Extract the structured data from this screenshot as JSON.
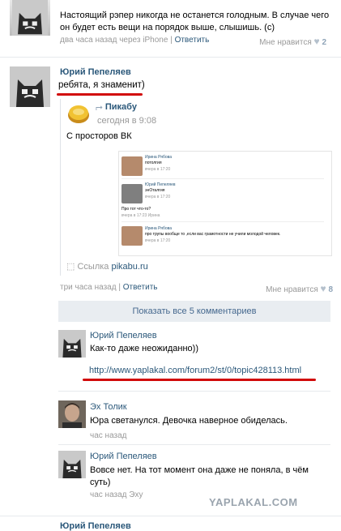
{
  "post1": {
    "text": "Настоящий рэпер никогда не останется голодным. В случае чего он будет есть вещи на порядок выше, слышишь. (с)",
    "time": "два часа назад через iPhone",
    "reply": "Ответить",
    "like": "Мне нравится",
    "likes": "2"
  },
  "post2": {
    "author": "Юрий Пепеляев",
    "text": "ребята, я знаменит)",
    "repost": {
      "source": "Пикабу",
      "time": "сегодня в 9:08",
      "text": "С просторов ВК",
      "img_comments": [
        {
          "author": "Ирина Рябова",
          "text": "потолгия",
          "time": "вчера в 17:20"
        },
        {
          "author": "Юрий Пепеляев",
          "text": "энОталгия",
          "time": "вчера в 17:20"
        },
        {
          "author": "",
          "text": "Про тот что-то?",
          "time": "вчера в 17:23 Ирина"
        },
        {
          "author": "Ирина Рябова",
          "text": "про трупы вообще то ,если вас грамотности не учили молодой человек.",
          "time": "вчера в 17:20"
        }
      ],
      "link_label": "Ссылка",
      "link_domain": "pikabu.ru"
    },
    "time": "три часа назад",
    "reply": "Ответить",
    "like": "Мне нравится",
    "likes": "8",
    "show_all": "Показать все 5 комментариев"
  },
  "comments": [
    {
      "author": "Юрий Пепеляев",
      "text": "Как-то даже неожиданно))",
      "url": "http://www.yaplakal.com/forum2/st/0/topic428113.html"
    },
    {
      "author": "Эх Толик",
      "text": "Юра светанулся. Девочка наверное обиделась.",
      "time": "час назад"
    },
    {
      "author": "Юрий Пепеляев",
      "text": "Вовсе нет. На тот момент она даже не поняла, в чём суть)",
      "time": "час назад Эху"
    }
  ],
  "watermark": "YAPLAKAL.COM",
  "post3": {
    "author": "Юрий Пепеляев"
  },
  "colors": {
    "link": "#2b587a",
    "underline": "#d10a0a",
    "show_bg": "#e9edf1"
  }
}
